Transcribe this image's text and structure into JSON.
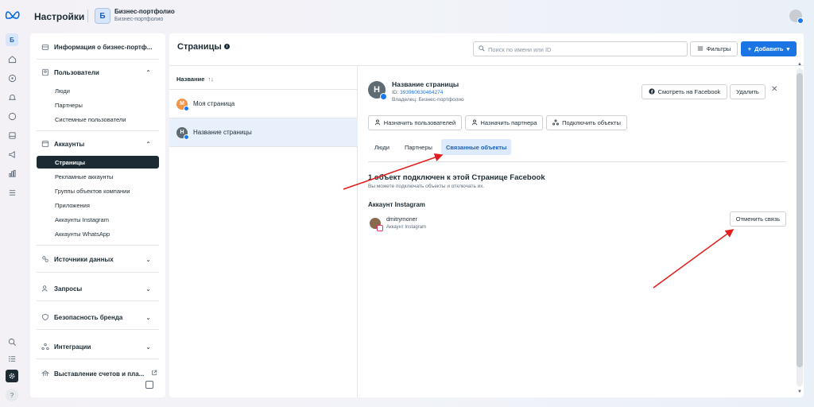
{
  "header": {
    "app_title": "Настройки",
    "business_avatar_letter": "Б",
    "business_name": "Бизнес-портфолио",
    "business_sub": "Бизнес-портфолио"
  },
  "rail": {
    "business_letter": "Б",
    "help_label": "?"
  },
  "nav": {
    "business_info": "Информация о бизнес-портф...",
    "users": {
      "label": "Пользователи",
      "items": [
        "Люди",
        "Партнеры",
        "Системные пользователи"
      ]
    },
    "accounts": {
      "label": "Аккаунты",
      "items": [
        "Страницы",
        "Рекламные аккаунты",
        "Группы объектов компании",
        "Приложения",
        "Аккаунты Instagram",
        "Аккаунты WhatsApp"
      ]
    },
    "data_sources": "Источники данных",
    "requests": "Запросы",
    "brand_safety": "Безопасность бренда",
    "integrations": "Интеграции",
    "billing": "Выставление счетов и пла..."
  },
  "main": {
    "title": "Страницы",
    "search_placeholder": "Поиск по имени или ID",
    "filters_label": "Фильтры",
    "add_label": "Добавить"
  },
  "list": {
    "column_header": "Название",
    "rows": [
      {
        "avatar_letter": "М",
        "name": "Моя страница",
        "avatar_color": "#f0954a"
      },
      {
        "avatar_letter": "Н",
        "name": "Название страницы",
        "avatar_color": "#5f6b73"
      }
    ]
  },
  "detail": {
    "avatar_letter": "Н",
    "page_name": "Название страницы",
    "id_label": "ID:",
    "id_value": "393960630464274",
    "owner": "Владелец: Бизнес-портфолио",
    "view_on_facebook": "Смотреть на Facebook",
    "delete": "Удалить",
    "assign_users": "Назначить пользователей",
    "assign_partner": "Назначить партнера",
    "connect_objects": "Подключить объекты",
    "tabs": [
      "Люди",
      "Партнеры",
      "Связанные объекты"
    ],
    "active_tab": "Связанные объекты",
    "connected_heading": "1 объект подключен к этой Странице Facebook",
    "connected_sub": "Вы можете подключать объекты и отключать их.",
    "instagram_heading": "Аккаунт Instagram",
    "ig_username": "dmitrymoner",
    "ig_type": "Аккаунт Instagram",
    "unlink": "Отменить связь"
  },
  "colors": {
    "accent": "#1b74e4",
    "annotation_arrow": "#e01e1e",
    "active_nav": "#1c2b33"
  }
}
